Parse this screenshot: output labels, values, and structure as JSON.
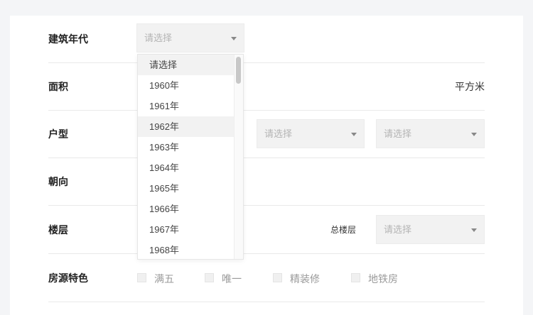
{
  "form": {
    "build_year": {
      "label": "建筑年代",
      "placeholder": "请选择"
    },
    "area": {
      "label": "面积",
      "unit": "平方米"
    },
    "layout": {
      "label": "户型",
      "select2_placeholder": "请选择",
      "select3_placeholder": "请选择"
    },
    "orientation": {
      "label": "朝向"
    },
    "floor": {
      "label": "楼层",
      "total_floors_label": "总楼层",
      "total_floors_placeholder": "请选择"
    },
    "features": {
      "label": "房源特色",
      "options": [
        "满五",
        "唯一",
        "精装修",
        "地铁房"
      ]
    }
  },
  "dropdown": {
    "options": [
      "请选择",
      "1960年",
      "1961年",
      "1962年",
      "1963年",
      "1964年",
      "1965年",
      "1966年",
      "1967年",
      "1968年"
    ],
    "highlighted": [
      "请选择",
      "1962年"
    ]
  }
}
